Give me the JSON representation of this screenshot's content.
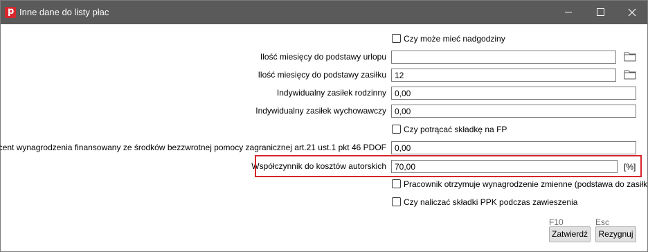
{
  "window": {
    "title": "Inne dane do listy płac"
  },
  "form": {
    "overtime_checkbox": "Czy może mieć nadgodziny",
    "vacation_months_label": "Ilość miesięcy do podstawy urlopu",
    "vacation_months_value": "",
    "allowance_months_label": "Ilość miesięcy do podstawy zasiłku",
    "allowance_months_value": "12",
    "family_allowance_label": "Indywidualny zasiłek rodzinny",
    "family_allowance_value": "0,00",
    "upbringing_allowance_label": "Indywidualny zasiłek wychowawczy",
    "upbringing_allowance_value": "0,00",
    "fp_checkbox": "Czy potrącać składkę na FP",
    "pdof_label": "Procent wynagrodzenia finansowany ze środków bezzwrotnej pomocy zagranicznej art.21 ust.1 pkt 46 PDOF",
    "pdof_value": "0,00",
    "author_costs_label": "Współczynnik do kosztów autorskich",
    "author_costs_value": "70,00",
    "author_costs_unit": "[%]",
    "variable_pay_checkbox": "Pracownik otrzymuje wynagrodzenie zmienne (podstawa do zasiłku)",
    "ppk_checkbox": "Czy naliczać składki PPK podczas zawieszenia"
  },
  "footer": {
    "confirm_key": "F10",
    "confirm_label": "Zatwierdź",
    "cancel_key": "Esc",
    "cancel_label": "Rezygnuj"
  }
}
